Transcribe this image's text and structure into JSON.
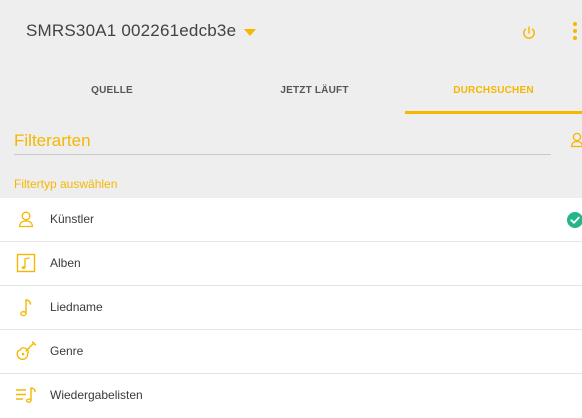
{
  "header": {
    "device_name": "SMRS30A1 002261edcb3e",
    "icons": {
      "dropdown": "caret-down-icon",
      "power": "power-icon",
      "more": "more-vert-icon"
    }
  },
  "tabs": [
    {
      "label": "QUELLE",
      "active": false
    },
    {
      "label": "JETZT LÄUFT",
      "active": false
    },
    {
      "label": "DURCHSUCHEN",
      "active": true
    }
  ],
  "filter": {
    "heading": "Filterarten",
    "type_label": "Filtertyp auswählen",
    "icon": "user-icon"
  },
  "filter_types": [
    {
      "label": "Künstler",
      "icon": "artist-icon",
      "selected": true
    },
    {
      "label": "Alben",
      "icon": "album-icon",
      "selected": false
    },
    {
      "label": "Liedname",
      "icon": "music-note-icon",
      "selected": false
    },
    {
      "label": "Genre",
      "icon": "guitar-icon",
      "selected": false
    },
    {
      "label": "Wiedergabelisten",
      "icon": "playlist-icon",
      "selected": false
    }
  ],
  "colors": {
    "accent": "#f5b700",
    "check": "#26b58a",
    "bar_background": "#eeeeee",
    "text": "#3a3a3a"
  }
}
